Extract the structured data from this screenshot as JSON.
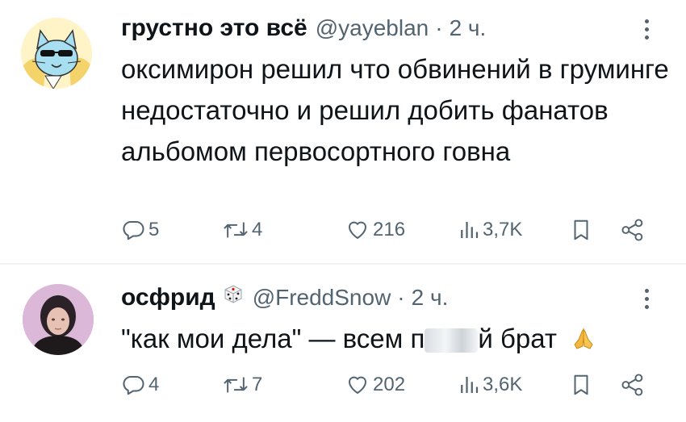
{
  "tweets": [
    {
      "author_name": "грустно это всё",
      "handle": "@yayeblan",
      "separator": "·",
      "time": "2 ч.",
      "text": "оксимирон решил что обвинений в груминге недостаточно и решил добить фанатов альбомом первосортного говна",
      "replies": "5",
      "retweets": "4",
      "likes": "216",
      "views": "3,7K"
    },
    {
      "author_name": "осфрид",
      "handle": "@FreddSnow",
      "separator": "·",
      "time": "2 ч.",
      "text_before": "\"как мои дела\" — всем п",
      "text_after": "й брат",
      "replies": "4",
      "retweets": "7",
      "likes": "202",
      "views": "3,6K"
    }
  ],
  "icons": {
    "reply": "reply-icon",
    "retweet": "retweet-icon",
    "like": "heart-icon",
    "views": "views-icon",
    "bookmark": "bookmark-icon",
    "share": "share-icon",
    "more": "more-icon"
  },
  "colors": {
    "text": "#0f1419",
    "secondary": "#536471",
    "divider": "#eff3f4"
  }
}
